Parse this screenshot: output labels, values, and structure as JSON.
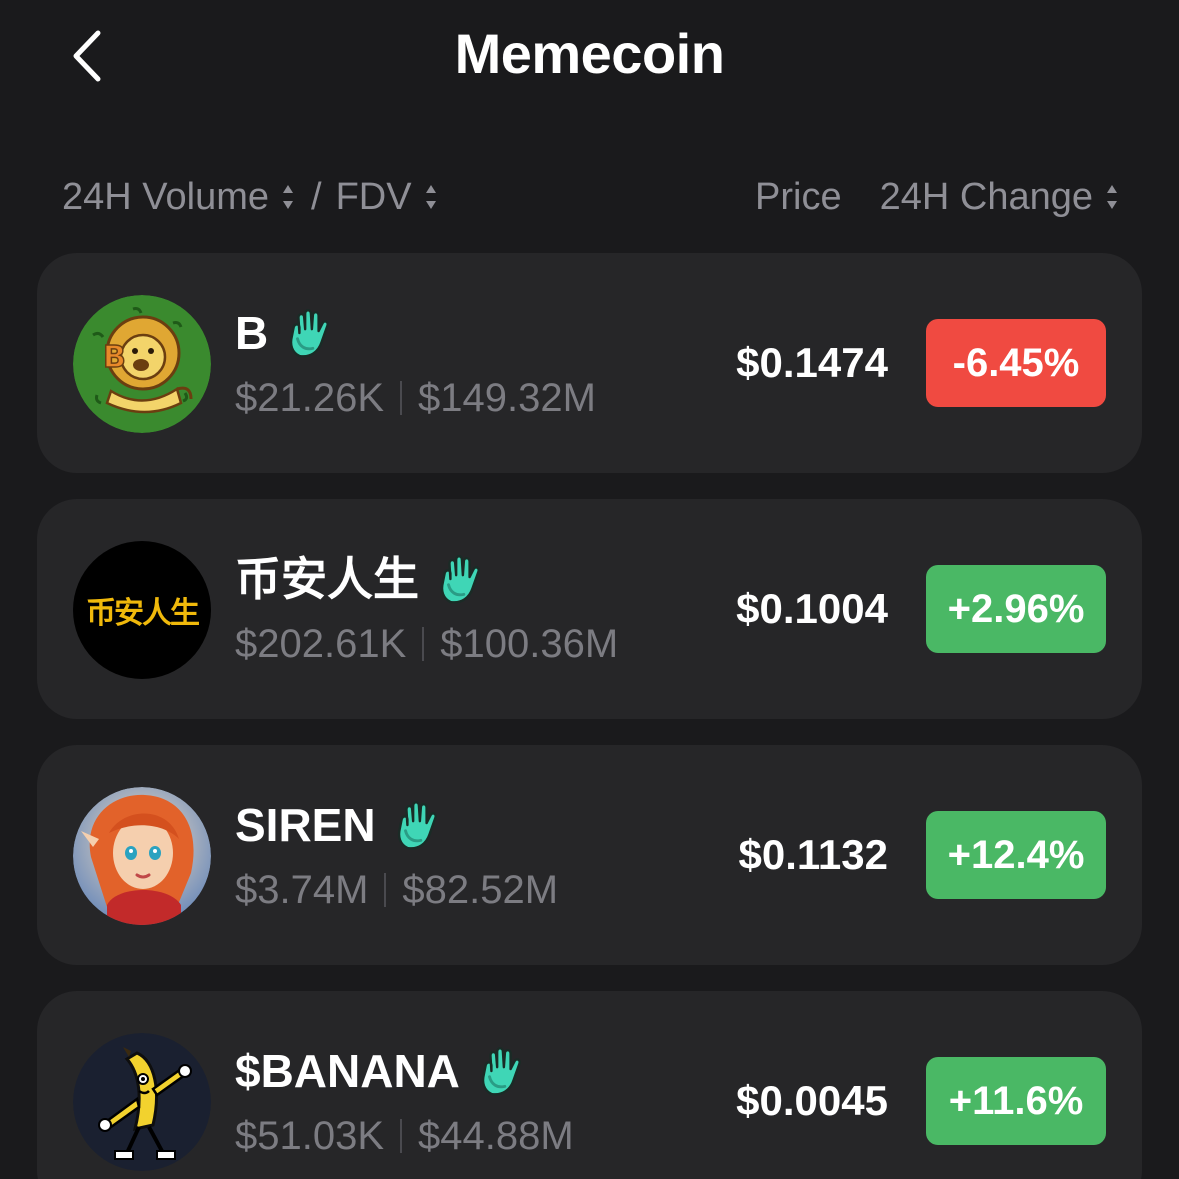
{
  "header": {
    "title": "Memecoin"
  },
  "columns": {
    "volume_label": "24H Volume",
    "separator": "/",
    "fdv_label": "FDV",
    "price_label": "Price",
    "change_label": "24H Change"
  },
  "colors": {
    "background": "#1a1a1c",
    "card": "#262628",
    "negative": "#f04a41",
    "positive": "#4ab865",
    "muted_text": "#8f8f96",
    "badge": "#3fd6b6"
  },
  "coins": [
    {
      "name": "B",
      "volume": "$21.26K",
      "fdv": "$149.32M",
      "price": "$0.1474",
      "change": "-6.45%",
      "direction": "down",
      "avatar": "lion-avatar-icon",
      "badge": "hand-badge-icon"
    },
    {
      "name": "币安人生",
      "volume": "$202.61K",
      "fdv": "$100.36M",
      "price": "$0.1004",
      "change": "+2.96%",
      "direction": "up",
      "avatar_text": "币安人生",
      "badge": "hand-badge-icon"
    },
    {
      "name": "SIREN",
      "volume": "$3.74M",
      "fdv": "$82.52M",
      "price": "$0.1132",
      "change": "+12.4%",
      "direction": "up",
      "avatar": "siren-avatar-icon",
      "badge": "hand-badge-icon"
    },
    {
      "name": "$BANANA",
      "volume": "$51.03K",
      "fdv": "$44.88M",
      "price": "$0.0045",
      "change": "+11.6%",
      "direction": "up",
      "avatar": "banana-avatar-icon",
      "badge": "hand-badge-icon"
    }
  ]
}
